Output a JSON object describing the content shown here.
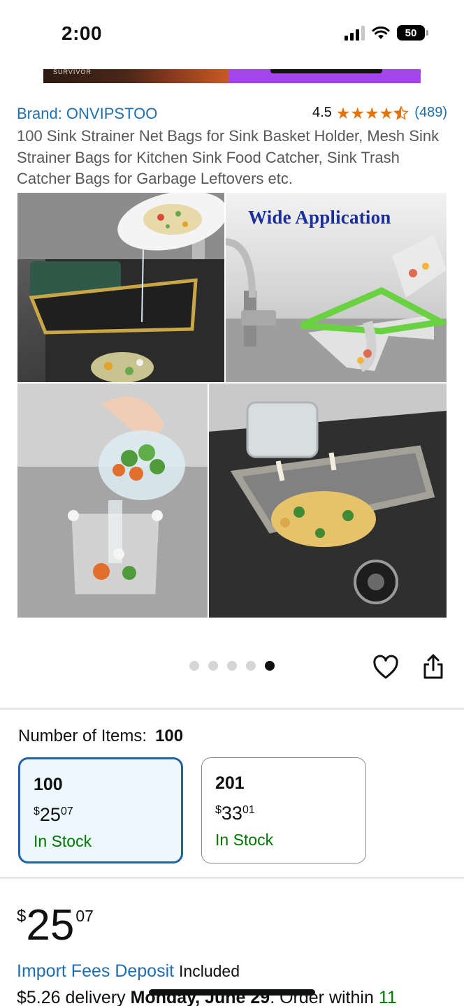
{
  "status_bar": {
    "time": "2:00",
    "battery": "50"
  },
  "ad": {
    "brand_text": "SURVIVOR"
  },
  "product": {
    "brand_label": "Brand: ONVIPSTOO",
    "rating": "4.5",
    "rating_count": "(489)",
    "stars": 4.5,
    "title": "100 Sink Strainer Net Bags for Sink Basket Holder, Mesh Sink Strainer Bags for Kitchen Sink Food Catcher, Sink Trash Catcher Bags for Garbage Leftovers etc.",
    "image_caption": "Wide Application",
    "carousel": {
      "count": 5,
      "active": 5
    }
  },
  "variations": {
    "label": "Number of Items:",
    "selected_value": "100",
    "options": [
      {
        "count": "100",
        "price_symbol": "$",
        "price_whole": "25",
        "price_cents": "07",
        "stock": "In Stock",
        "selected": true
      },
      {
        "count": "201",
        "price_symbol": "$",
        "price_whole": "33",
        "price_cents": "01",
        "stock": "In Stock",
        "selected": false
      }
    ]
  },
  "price": {
    "symbol": "$",
    "whole": "25",
    "cents": "07"
  },
  "import_fees": {
    "link": "Import Fees Deposit",
    "suffix": "Included"
  },
  "delivery": {
    "prefix": "$5.26 delivery",
    "date": "Monday, June 29",
    "suffix": ". Order within",
    "time": "11"
  },
  "colors": {
    "link": "#1f6fb0",
    "in_stock": "#007600",
    "star": "#e2730d",
    "selected_border": "#2162a1",
    "selected_bg": "#edf8fe"
  }
}
